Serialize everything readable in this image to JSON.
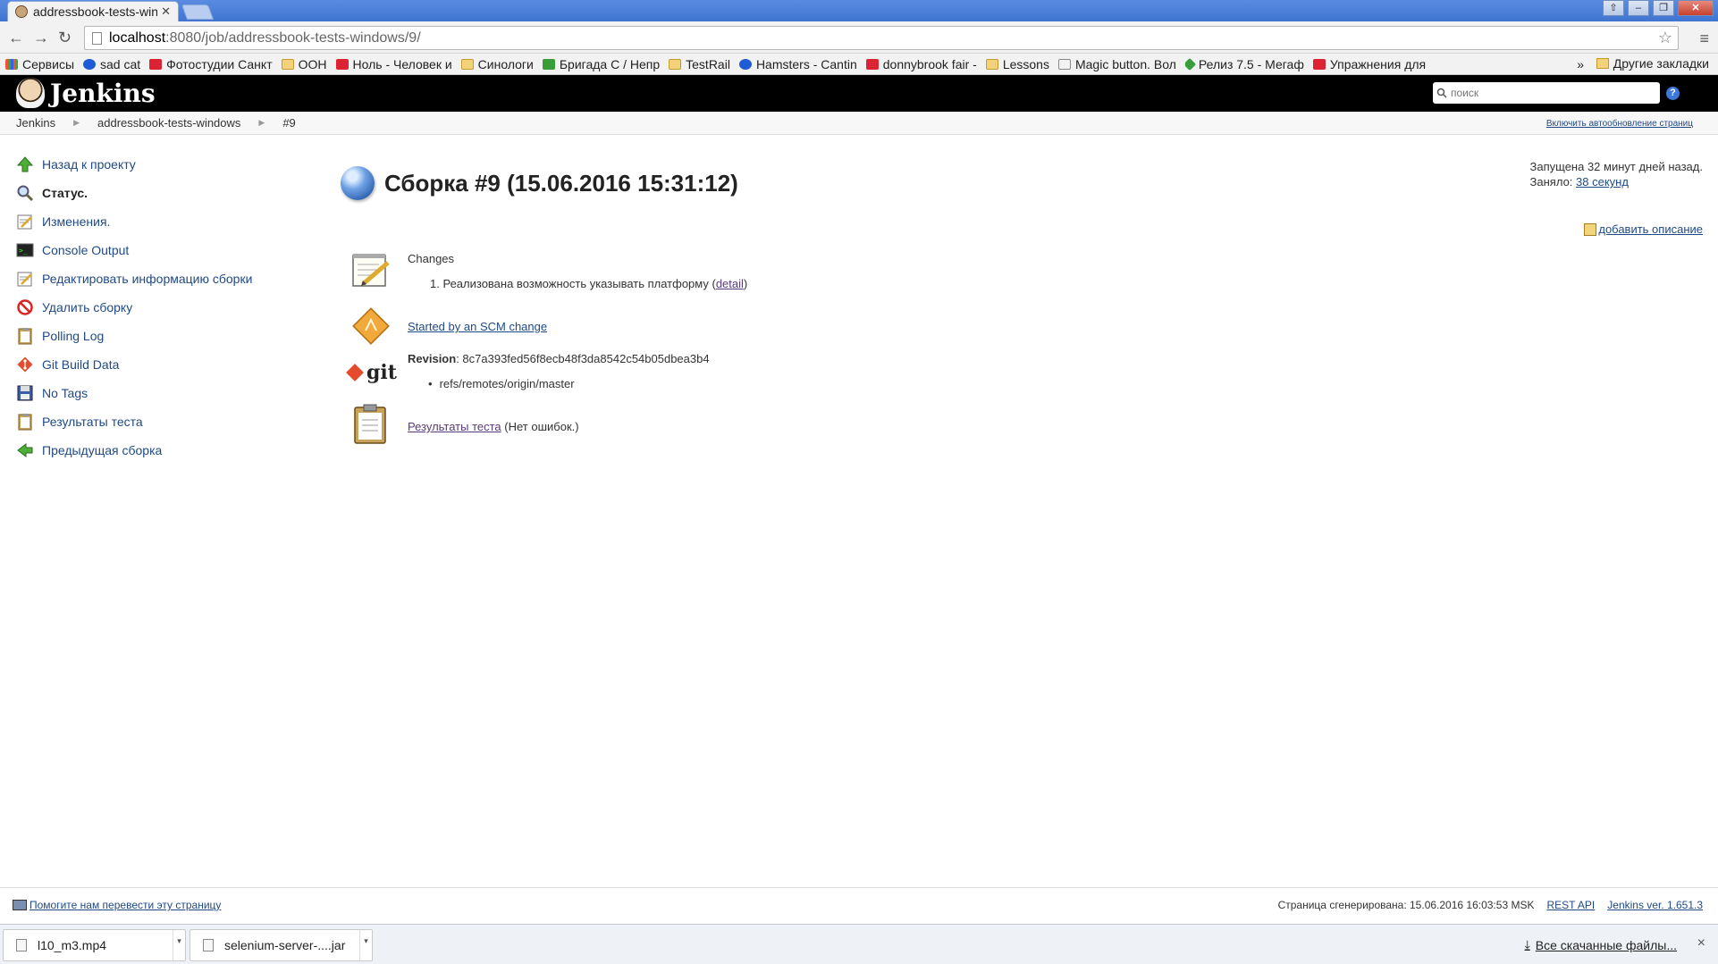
{
  "browser": {
    "tab_title": "addressbook-tests-windows",
    "url_host": "localhost",
    "url_path": ":8080/job/addressbook-tests-windows/9/",
    "bookmarks": [
      {
        "label": "Сервисы",
        "icon": "apps-grid-icon"
      },
      {
        "label": "sad cat",
        "icon": "circle-c-icon"
      },
      {
        "label": "Фотостудии Санкт",
        "icon": "sr-icon"
      },
      {
        "label": "ООН",
        "icon": "folder-icon"
      },
      {
        "label": "Ноль - Человек и",
        "icon": "red-icon"
      },
      {
        "label": "Синологи",
        "icon": "folder-icon"
      },
      {
        "label": "Бригада С / Непр",
        "icon": "green-icon"
      },
      {
        "label": "TestRail",
        "icon": "folder-icon"
      },
      {
        "label": "Hamsters - Cantin",
        "icon": "circle-c-icon"
      },
      {
        "label": "donnybrook fair -",
        "icon": "youtube-icon"
      },
      {
        "label": "Lessons",
        "icon": "folder-icon"
      },
      {
        "label": "Magic button. Вол",
        "icon": "page-icon"
      },
      {
        "label": "Релиз 7.5 - Мегаф",
        "icon": "green-diamond-icon"
      },
      {
        "label": "Упражнения для",
        "icon": "youtube-icon"
      }
    ],
    "bookmarks_more": "»",
    "other_bookmarks": "Другие закладки"
  },
  "jenkins": {
    "title": "Jenkins",
    "search_placeholder": "поиск",
    "help": "?",
    "breadcrumbs": [
      "Jenkins",
      "addressbook-tests-windows",
      "#9"
    ],
    "autorefresh": "Включить автообновление страниц",
    "side": [
      {
        "label": "Назад к проекту",
        "icon": "up-arrow-icon"
      },
      {
        "label": "Статус.",
        "icon": "magnifier-icon"
      },
      {
        "label": "Изменения.",
        "icon": "notepad-icon"
      },
      {
        "label": "Console Output",
        "icon": "terminal-icon"
      },
      {
        "label": "Редактировать информацию сборки",
        "icon": "notepad-icon"
      },
      {
        "label": "Удалить сборку",
        "icon": "no-entry-icon"
      },
      {
        "label": "Polling Log",
        "icon": "clipboard-icon"
      },
      {
        "label": "Git Build Data",
        "icon": "git-icon"
      },
      {
        "label": "No Tags",
        "icon": "floppy-icon"
      },
      {
        "label": "Результаты теста",
        "icon": "clipboard-icon"
      },
      {
        "label": "Предыдущая сборка",
        "icon": "left-arrow-icon"
      }
    ],
    "build_title": "Сборка #9 (15.06.2016 15:31:12)",
    "started_ago": "Запущена 32 минут дней назад.",
    "took_label": "Заняло:",
    "took_value": "38 секунд",
    "add_description": "добавить описание",
    "changes_label": "Changes",
    "change_number": "1.",
    "change_text": "Реализована возможность указывать платформу",
    "change_detail": "detail",
    "started_by": "Started by an SCM change",
    "revision_label": "Revision",
    "revision_value": "8c7a393fed56f8ecb48f3da8542c54b05dbea3b4",
    "ref": "refs/remotes/origin/master",
    "git_logo": "git",
    "test_results_link": "Результаты теста",
    "test_results_note": "(Нет ошибок.)"
  },
  "footer": {
    "translate": "Помогите нам перевести эту страницу",
    "generated": "Страница сгенерирована: 15.06.2016 16:03:53 MSK",
    "rest_api": "REST API",
    "version": "Jenkins ver. 1.651.3"
  },
  "downloads": {
    "items": [
      "l10_m3.mp4",
      "selenium-server-....jar"
    ],
    "all": "Все скачанные файлы...",
    "close": "×"
  }
}
